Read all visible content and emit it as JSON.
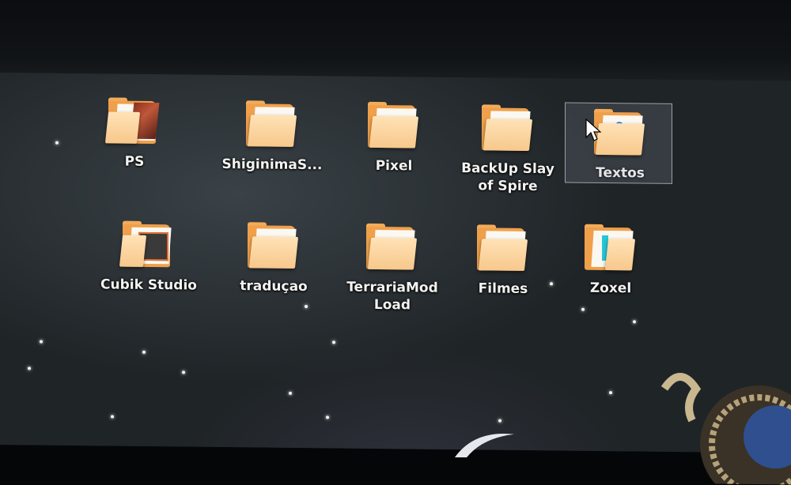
{
  "desktop": {
    "icons": [
      {
        "label": "PS",
        "selected": false,
        "icon": "folder-icon"
      },
      {
        "label": "ShiginimaS...",
        "selected": false,
        "icon": "folder-icon"
      },
      {
        "label": "Pixel",
        "selected": false,
        "icon": "folder-icon"
      },
      {
        "label": "BackUp Slay\nof Spire",
        "selected": false,
        "icon": "folder-icon"
      },
      {
        "label": "Textos",
        "selected": true,
        "icon": "folder-icon"
      },
      {
        "label": "Cubik Studio",
        "selected": false,
        "icon": "folder-icon"
      },
      {
        "label": "traduçao",
        "selected": false,
        "icon": "folder-icon"
      },
      {
        "label": "TerrariaMod\nLoad",
        "selected": false,
        "icon": "folder-icon"
      },
      {
        "label": "Filmes",
        "selected": false,
        "icon": "folder-icon"
      },
      {
        "label": "Zoxel",
        "selected": false,
        "icon": "folder-icon"
      }
    ]
  },
  "colors": {
    "folder": "#f0a04a",
    "folder_front": "#ffe2b6",
    "label": "#f2f2f0",
    "wallpaper": "#2b3135"
  }
}
